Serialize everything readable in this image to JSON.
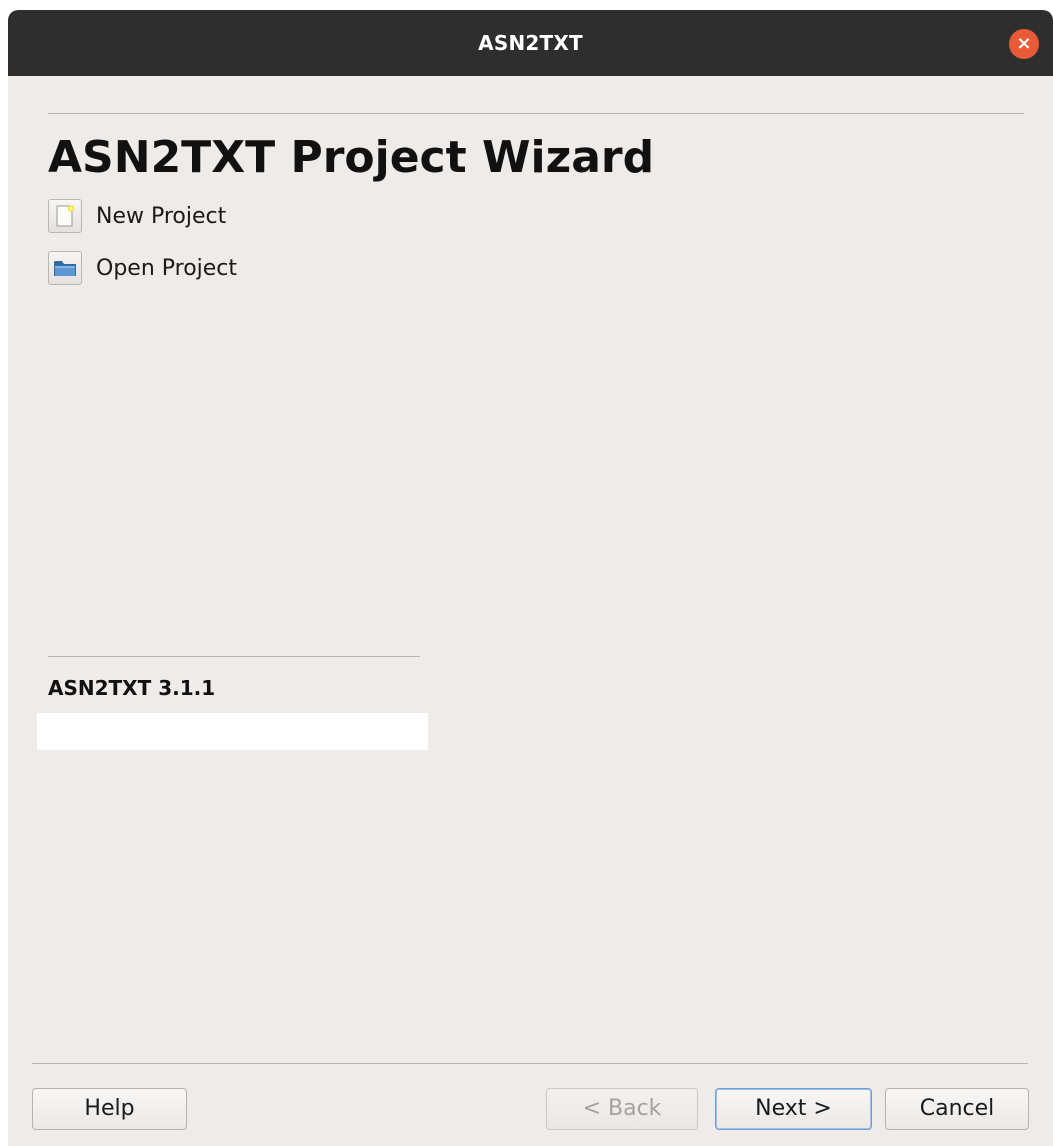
{
  "window": {
    "title": "ASN2TXT",
    "close_symbol": "×"
  },
  "wizard": {
    "title": "ASN2TXT Project Wizard",
    "options": [
      {
        "label": "New Project",
        "icon": "new-file-icon"
      },
      {
        "label": "Open Project",
        "icon": "folder-icon"
      }
    ],
    "version": "ASN2TXT 3.1.1"
  },
  "buttons": {
    "help": "Help",
    "back": "< Back",
    "next": "Next >",
    "cancel": "Cancel"
  },
  "colors": {
    "titlebar": "#2e2e2e",
    "close": "#e95b36",
    "window_bg": "#efebe9",
    "default_button_border": "#6f9fd2"
  }
}
